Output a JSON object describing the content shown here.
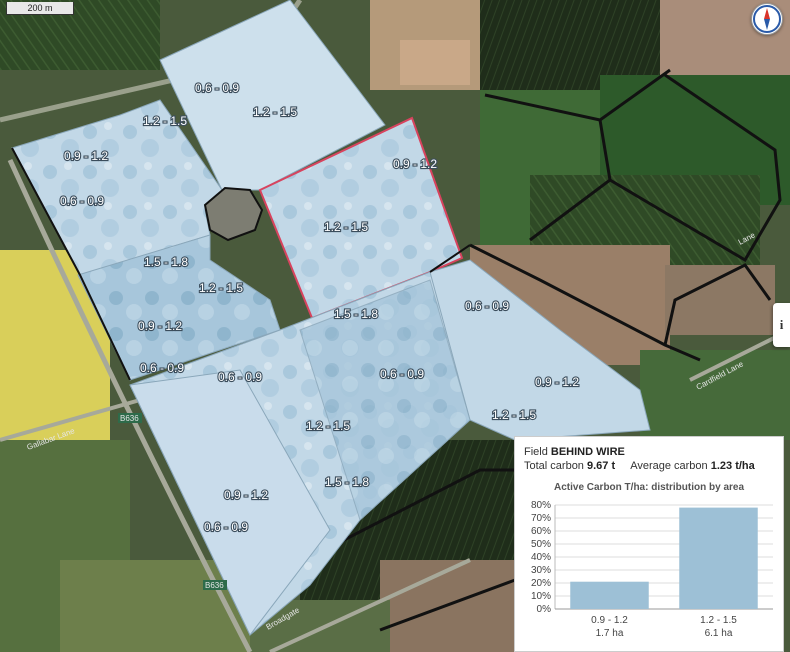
{
  "map": {
    "scale_label": "200 m",
    "info_button_label": "i",
    "zone_labels": [
      "0.6 - 0.9",
      "1.2 - 1.5",
      "1.2 - 1.5",
      "0.9 - 1.2",
      "0.6 - 0.9",
      "0.9 - 1.2",
      "1.2 - 1.5",
      "1.5 - 1.8",
      "1.2 - 1.5",
      "0.9 - 1.2",
      "0.6 - 0.9",
      "1.5 - 1.8",
      "0.6 - 0.9",
      "0.6 - 0.9",
      "0.6 - 0.9",
      "0.9 - 1.2",
      "1.2 - 1.5",
      "1.2 - 1.5",
      "1.5 - 1.8",
      "0.9 - 1.2",
      "0.6 - 0.9"
    ],
    "road_labels": [
      "B636",
      "B636",
      "Gallabar Lane",
      "Cardfield Lane",
      "Broadgate",
      "Lane"
    ]
  },
  "panel": {
    "field_prefix": "Field",
    "field_name": "BEHIND WIRE",
    "total_label": "Total carbon",
    "total_value": "9.67 t",
    "avg_label": "Average carbon",
    "avg_value": "1.23 t/ha",
    "chart_title": "Active Carbon T/ha: distribution by area"
  },
  "chart_data": {
    "type": "bar",
    "title": "Active Carbon T/ha: distribution by area",
    "categories": [
      "0.9 - 1.2",
      "1.2 - 1.5"
    ],
    "category_areas": [
      "1.7 ha",
      "6.1 ha"
    ],
    "values": [
      21,
      78
    ],
    "unit": "%",
    "ylim": [
      0,
      80
    ],
    "yticks": [
      "0%",
      "10%",
      "20%",
      "30%",
      "40%",
      "50%",
      "60%",
      "70%",
      "80%"
    ],
    "bar_color": "#9dc0d6",
    "grid": true
  }
}
